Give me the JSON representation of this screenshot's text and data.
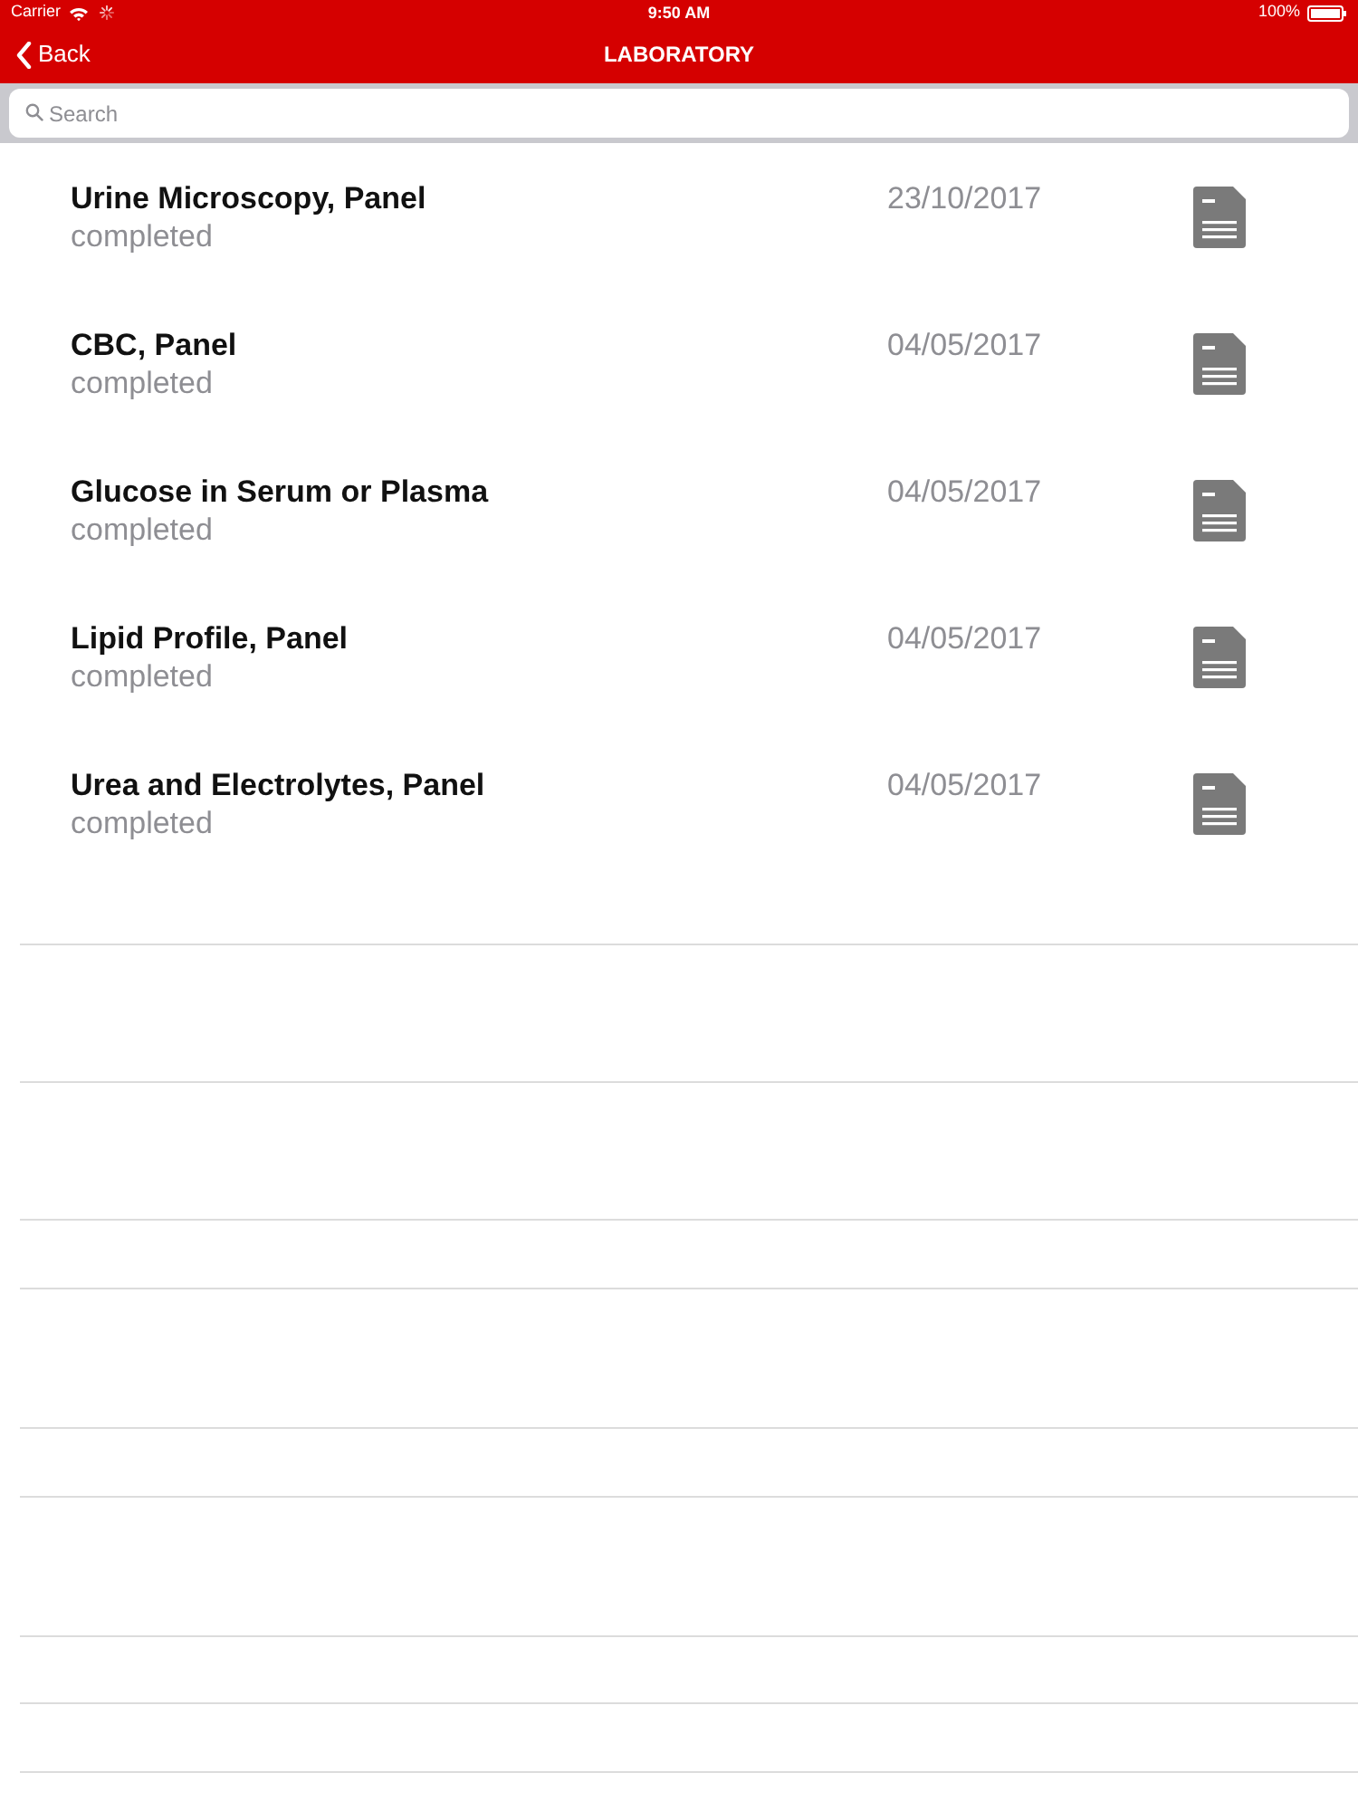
{
  "status_bar": {
    "carrier": "Carrier",
    "time": "9:50 AM",
    "battery": "100%"
  },
  "nav": {
    "back": "Back",
    "title": "LABORATORY"
  },
  "search": {
    "placeholder": "Search"
  },
  "results": [
    {
      "name": "Urine Microscopy, Panel",
      "status": "completed",
      "date": "23/10/2017"
    },
    {
      "name": "CBC, Panel",
      "status": "completed",
      "date": "04/05/2017"
    },
    {
      "name": "Glucose in Serum or Plasma",
      "status": "completed",
      "date": "04/05/2017"
    },
    {
      "name": "Lipid Profile, Panel",
      "status": "completed",
      "date": "04/05/2017"
    },
    {
      "name": "Urea and Electrolytes, Panel",
      "status": "completed",
      "date": "04/05/2017"
    }
  ]
}
